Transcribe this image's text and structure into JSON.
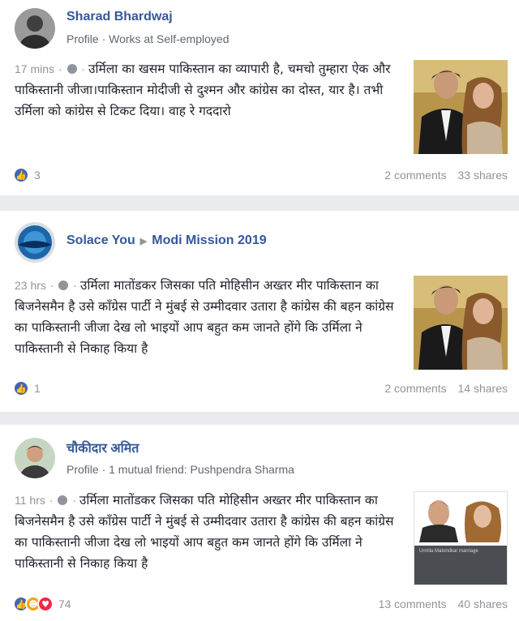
{
  "posts": [
    {
      "author": "Sharad Bhardwaj",
      "subline": "Profile · Works at Self-employed",
      "time": "17 mins",
      "text": "उर्मिला का खसम पाकिस्तान का व्यापारी है, चमचो तुम्हारा ऐक और पाकिस्तानी जीजा।पाकिस्तान मोदीजी से दुश्मन और कांग्रेस का दोस्त, यार है। तभी उर्मिला को कांग्रेस से टिकट दिया। वाह रे गददारो",
      "reactions_count": "3",
      "comments": "2 comments",
      "shares": "33 shares",
      "avatar_icon": "profile-photo-icon",
      "image_icon": "couple-photo-icon"
    },
    {
      "author": "Solace You",
      "shared_to": "Modi Mission 2019",
      "time": "23 hrs",
      "text": "उर्मिला मातोंडकर जिसका पति मोहिसीन अख्तर मीर पाकिस्तान का बिजनेसमैन है उसे कॉंग्रेस पार्टी ने मुंबई से उम्मीदवार उतारा है कांग्रेस की बहन कांग्रेस का पाकिस्तानी जीजा देख लो भाइयों आप बहुत कम जानते होंगे कि उर्मिला ने पाकिस्तानी से निकाह किया है",
      "reactions_count": "1",
      "comments": "2 comments",
      "shares": "14 shares"
    },
    {
      "author": "चौकीदार अमित",
      "subline": "Profile · 1 mutual friend: Pushpendra Sharma",
      "time": "11 hrs",
      "text": "उर्मिला मातोंडकर जिसका पति मोहिसीन अख्तर मीर पाकिस्तान का बिजनेसमैन है उसे कॉंग्रेस पार्टी ने मुंबई से उम्मीदवार उतारा है कांग्रेस की बहन कांग्रेस का पाकिस्तानी जीजा देख लो भाइयों आप बहुत कम जानते होंगे कि उर्मिला ने पाकिस्तानी से निकाह किया है",
      "reactions_count": "74",
      "comments": "13 comments",
      "shares": "40 shares",
      "image_caption": "Urmila Matondkar marriage"
    }
  ],
  "colors": {
    "link": "#365899",
    "muted": "#90949c",
    "like": "#4267b2",
    "love": "#f0284a",
    "angry": "#f2a31a",
    "background": "#e9ebee"
  }
}
